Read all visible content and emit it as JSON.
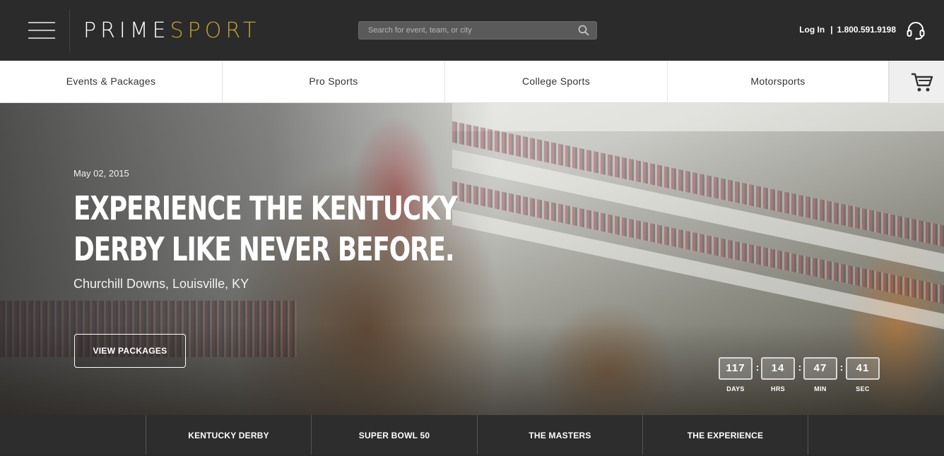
{
  "header": {
    "logo_prime": "PRIME",
    "logo_sport": "SPORT",
    "search_placeholder": "Search for event, team, or city",
    "login_label": "Log In",
    "separator": "|",
    "phone": "1.800.591.9198"
  },
  "nav": {
    "items": [
      {
        "label": "Events & Packages"
      },
      {
        "label": "Pro Sports"
      },
      {
        "label": "College Sports"
      },
      {
        "label": "Motorsports"
      }
    ]
  },
  "hero": {
    "date": "May 02, 2015",
    "headline_line1": "EXPERIENCE THE KENTUCKY",
    "headline_line2": "DERBY LIKE NEVER BEFORE.",
    "venue": "Churchill Downs, Louisville, KY",
    "cta_label": "VIEW PACKAGES",
    "countdown": {
      "separator": ":",
      "units": [
        {
          "value": "117",
          "label": "DAYS"
        },
        {
          "value": "14",
          "label": "HRS"
        },
        {
          "value": "47",
          "label": "MIN"
        },
        {
          "value": "41",
          "label": "SEC"
        }
      ]
    }
  },
  "tabs": [
    {
      "label": "KENTUCKY DERBY"
    },
    {
      "label": "SUPER BOWL 50"
    },
    {
      "label": "THE MASTERS"
    },
    {
      "label": "THE EXPERIENCE"
    }
  ],
  "colors": {
    "header_bg": "#2b2b2b",
    "logo_accent": "#c2a234",
    "nav_bg": "#ffffff",
    "cart_bg": "#efefef"
  },
  "icons": [
    "hamburger-menu-icon",
    "search-icon",
    "headset-icon",
    "cart-icon"
  ]
}
